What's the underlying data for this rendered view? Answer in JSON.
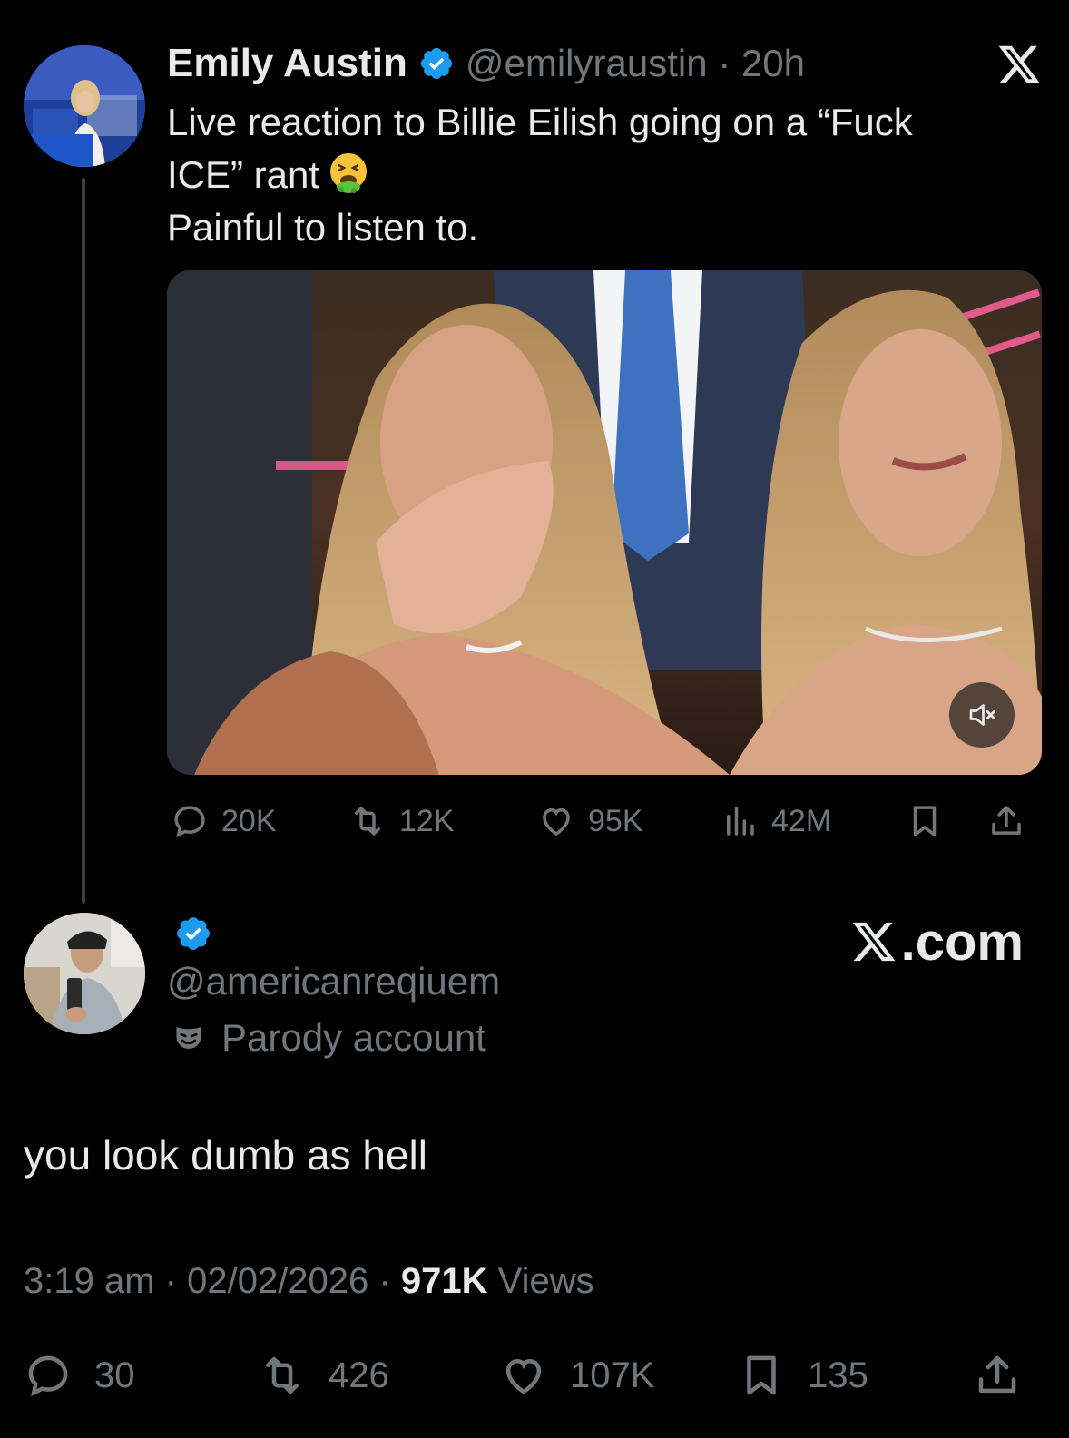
{
  "original_tweet": {
    "author_name": "Emily Austin",
    "handle_time": "@emilyraustin · 20h",
    "text_line1": "Live reaction to Billie Eilish going on a “Fuck",
    "text_line2": "ICE” rant",
    "text_line3": "Painful to listen to.",
    "emoji": "vomiting-face-icon",
    "video_muted": true,
    "stats": {
      "replies": "20K",
      "reposts": "12K",
      "likes": "95K",
      "views": "42M"
    }
  },
  "reply": {
    "handle": "@americanreqiuem",
    "account_label": "Parody account",
    "text": "you look dumb as hell",
    "time": "3:19 am",
    "date": "02/02/2026",
    "views_count": "971K",
    "views_label": "Views",
    "stats": {
      "replies": "30",
      "reposts": "426",
      "likes": "107K",
      "bookmarks": "135"
    }
  },
  "branding": {
    "site": ".com"
  },
  "colors": {
    "background": "#000000",
    "text_primary": "#e7e9ea",
    "text_secondary": "#71767b",
    "verified_blue": "#1d9bf0"
  }
}
